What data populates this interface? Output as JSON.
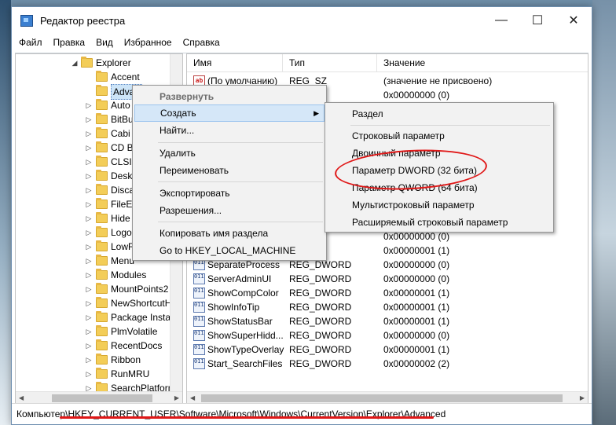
{
  "window": {
    "title": "Редактор реестра",
    "minimize_glyph": "—",
    "maximize_glyph": "☐",
    "close_glyph": "✕"
  },
  "menu": [
    "Файл",
    "Правка",
    "Вид",
    "Избранное",
    "Справка"
  ],
  "tree": {
    "parent": "Explorer",
    "items": [
      "Accent",
      "Advanced",
      "AutoplayHandlers",
      "BitBucket",
      "CabinetState",
      "CD Burning",
      "CLSID",
      "Desktop",
      "Discardable",
      "FileExts",
      "HideDesktopIcons",
      "LogonStats",
      "LowRegistry",
      "MenuOrder",
      "Modules",
      "MountPoints2",
      "NewShortcutHandlers",
      "Package Installation",
      "PlmVolatile",
      "RecentDocs",
      "Ribbon",
      "RunMRU",
      "SearchPlatform"
    ],
    "visible_labels": [
      "Accent",
      "Advan",
      "Auto",
      "BitBu",
      "Cabi",
      "CD B",
      "CLSI",
      "Desk",
      "Disca",
      "FileE",
      "Hide",
      "Logo",
      "LowR",
      "Menu",
      "Modules",
      "MountPoints2",
      "NewShortcutH",
      "Package Instal",
      "PlmVolatile",
      "RecentDocs",
      "Ribbon",
      "RunMRU",
      "SearchPlatform"
    ]
  },
  "list": {
    "columns": [
      "Имя",
      "Тип",
      "Значение"
    ],
    "rows": [
      {
        "name": "(По умолчанию)",
        "type": "REG_SZ",
        "value": "(значение не присвоено)",
        "icon": "string-value-icon"
      },
      {
        "name": "",
        "type": "",
        "value": "0x00000000 (0)",
        "icon": "dword-value-icon"
      },
      {
        "name": "",
        "type": "",
        "value": "0x00000000 (0)",
        "icon": "dword-value-icon"
      },
      {
        "name": "",
        "type": "",
        "value": "0x00000001 (1)",
        "icon": "dword-value-icon"
      },
      {
        "name": "SeparateProcess",
        "type": "REG_DWORD",
        "value": "0x00000000 (0)",
        "icon": "dword-value-icon"
      },
      {
        "name": "ServerAdminUI",
        "type": "REG_DWORD",
        "value": "0x00000000 (0)",
        "icon": "dword-value-icon"
      },
      {
        "name": "ShowCompColor",
        "type": "REG_DWORD",
        "value": "0x00000001 (1)",
        "icon": "dword-value-icon"
      },
      {
        "name": "ShowInfoTip",
        "type": "REG_DWORD",
        "value": "0x00000001 (1)",
        "icon": "dword-value-icon"
      },
      {
        "name": "ShowStatusBar",
        "type": "REG_DWORD",
        "value": "0x00000001 (1)",
        "icon": "dword-value-icon"
      },
      {
        "name": "ShowSuperHidd...",
        "type": "REG_DWORD",
        "value": "0x00000000 (0)",
        "icon": "dword-value-icon"
      },
      {
        "name": "ShowTypeOverlay",
        "type": "REG_DWORD",
        "value": "0x00000001 (1)",
        "icon": "dword-value-icon"
      },
      {
        "name": "Start_SearchFiles",
        "type": "REG_DWORD",
        "value": "0x00000002 (2)",
        "icon": "dword-value-icon"
      }
    ]
  },
  "context_menu": {
    "items": [
      "Развернуть",
      "Создать",
      "Найти...",
      "Удалить",
      "Переименовать",
      "Экспортировать",
      "Разрешения...",
      "Копировать имя раздела",
      "Go to HKEY_LOCAL_MACHINE"
    ]
  },
  "submenu": {
    "items": [
      "Раздел",
      "Строковый параметр",
      "Двоичный параметр",
      "Параметр DWORD (32 бита)",
      "Параметр QWORD (64 бита)",
      "Мультистроковый параметр",
      "Расширяемый строковый параметр"
    ]
  },
  "status": {
    "path": "Компьютер\\HKEY_CURRENT_USER\\Software\\Microsoft\\Windows\\CurrentVersion\\Explorer\\Advanced"
  },
  "colors": {
    "highlight": "#e01818",
    "selection": "#cce4f7",
    "menu_hover": "#d5e7f8"
  }
}
